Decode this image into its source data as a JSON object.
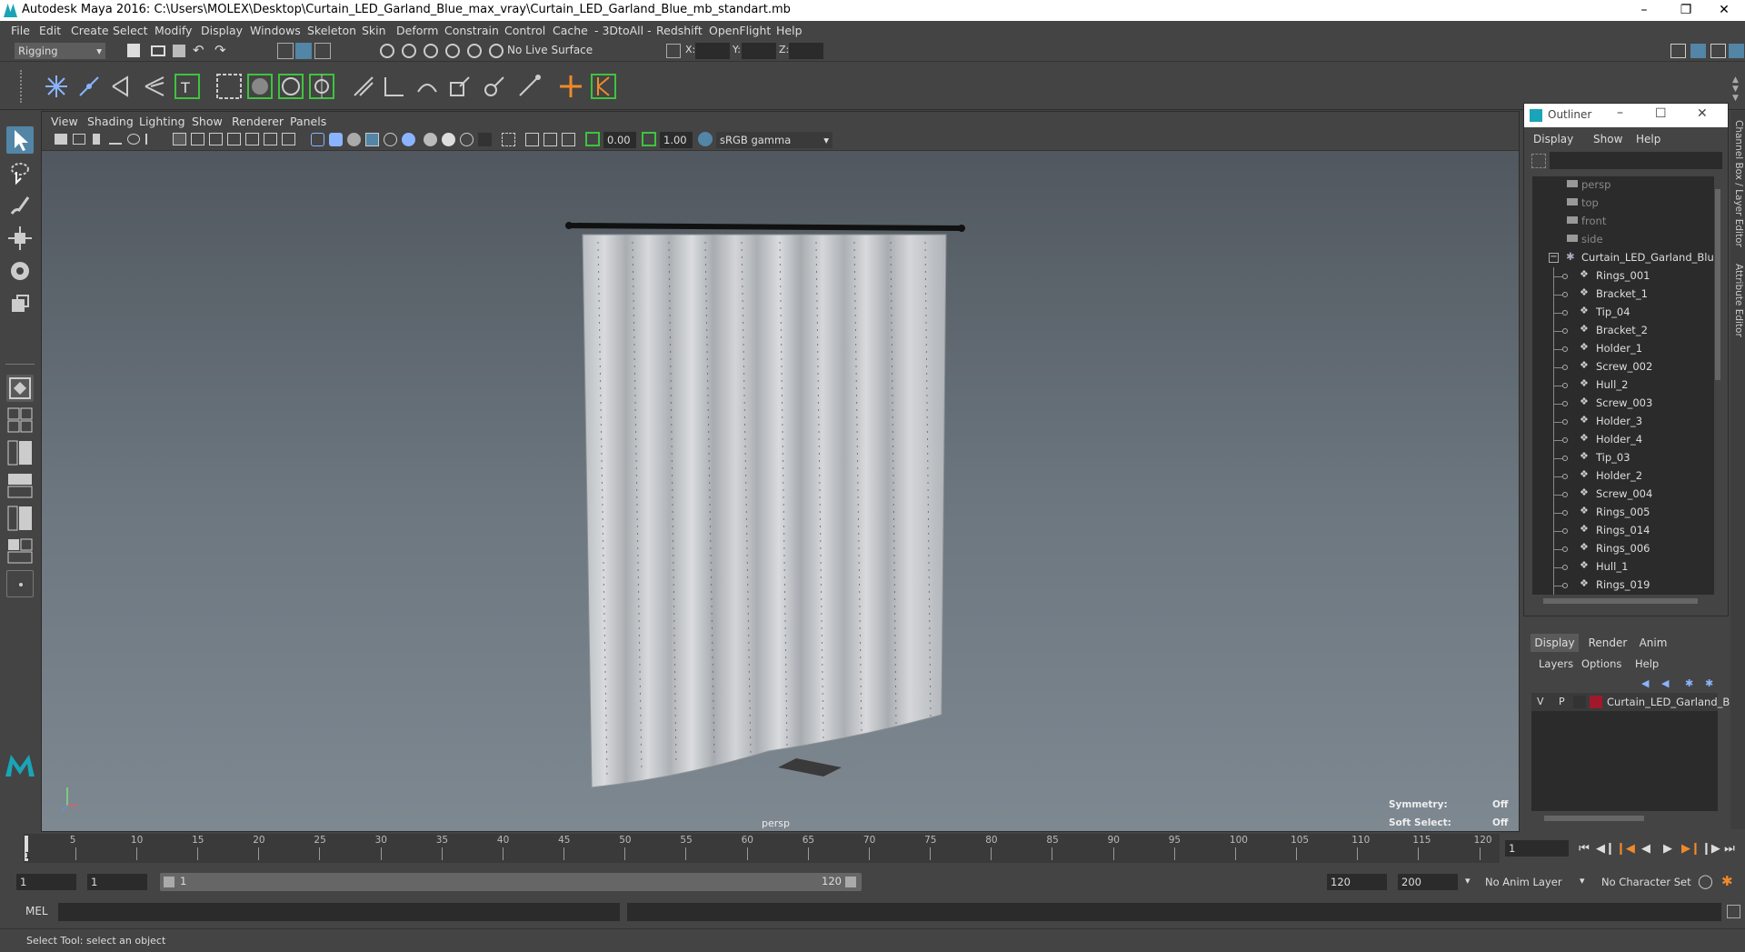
{
  "window": {
    "title": "Autodesk Maya 2016: C:\\Users\\MOLEX\\Desktop\\Curtain_LED_Garland_Blue_max_vray\\Curtain_LED_Garland_Blue_mb_standart.mb"
  },
  "menu": [
    "File",
    "Edit",
    "Create",
    "Select",
    "Modify",
    "Display",
    "Windows",
    "Skeleton",
    "Skin",
    "Deform",
    "Constrain",
    "Control",
    "Cache",
    "- 3DtoAll -",
    "Redshift",
    "OpenFlight",
    "Help"
  ],
  "status_line": {
    "mode": "Rigging",
    "live_surface": "No Live Surface",
    "x_label": "X:",
    "y_label": "Y:",
    "z_label": "Z:"
  },
  "viewport": {
    "menu": [
      "View",
      "Shading",
      "Lighting",
      "Show",
      "Renderer",
      "Panels"
    ],
    "exposure": "0.00",
    "gamma": "1.00",
    "color_space": "sRGB gamma",
    "camera_label": "persp",
    "hud": {
      "symmetry_label": "Symmetry:",
      "symmetry_value": "Off",
      "soft_select_label": "Soft Select:",
      "soft_select_value": "Off"
    }
  },
  "outliner": {
    "title": "Outliner",
    "menu": [
      "Display",
      "Show",
      "Help"
    ],
    "cameras": [
      "persp",
      "top",
      "front",
      "side"
    ],
    "root": "Curtain_LED_Garland_Blue_(",
    "children": [
      "Rings_001",
      "Bracket_1",
      "Tip_04",
      "Bracket_2",
      "Holder_1",
      "Screw_002",
      "Hull_2",
      "Screw_003",
      "Holder_3",
      "Holder_4",
      "Tip_03",
      "Holder_2",
      "Screw_004",
      "Rings_005",
      "Rings_014",
      "Rings_006",
      "Hull_1",
      "Rings_019"
    ]
  },
  "side_tabs": {
    "channel_box": "Channel Box / Layer Editor",
    "attribute_editor": "Attribute Editor"
  },
  "layer_editor": {
    "tabs": [
      "Display",
      "Render",
      "Anim"
    ],
    "menu": [
      "Layers",
      "Options",
      "Help"
    ],
    "layer": {
      "v": "V",
      "p": "P",
      "name": "Curtain_LED_Garland_B",
      "color": "#a0182c"
    }
  },
  "timeline": {
    "ticks": [
      "5",
      "10",
      "15",
      "20",
      "25",
      "30",
      "35",
      "40",
      "45",
      "50",
      "55",
      "60",
      "65",
      "70",
      "75",
      "80",
      "85",
      "90",
      "95",
      "100",
      "105",
      "110",
      "115",
      "120"
    ],
    "start_tick": "1",
    "current_frame": "1"
  },
  "range": {
    "start": "1",
    "playback_start": "1",
    "slider_start": "1",
    "slider_end": "120",
    "playback_end": "120",
    "end": "200",
    "anim_layer": "No Anim Layer",
    "character_set": "No Character Set"
  },
  "command_line": {
    "label": "MEL"
  },
  "help_line": {
    "text": "Select Tool: select an object"
  }
}
